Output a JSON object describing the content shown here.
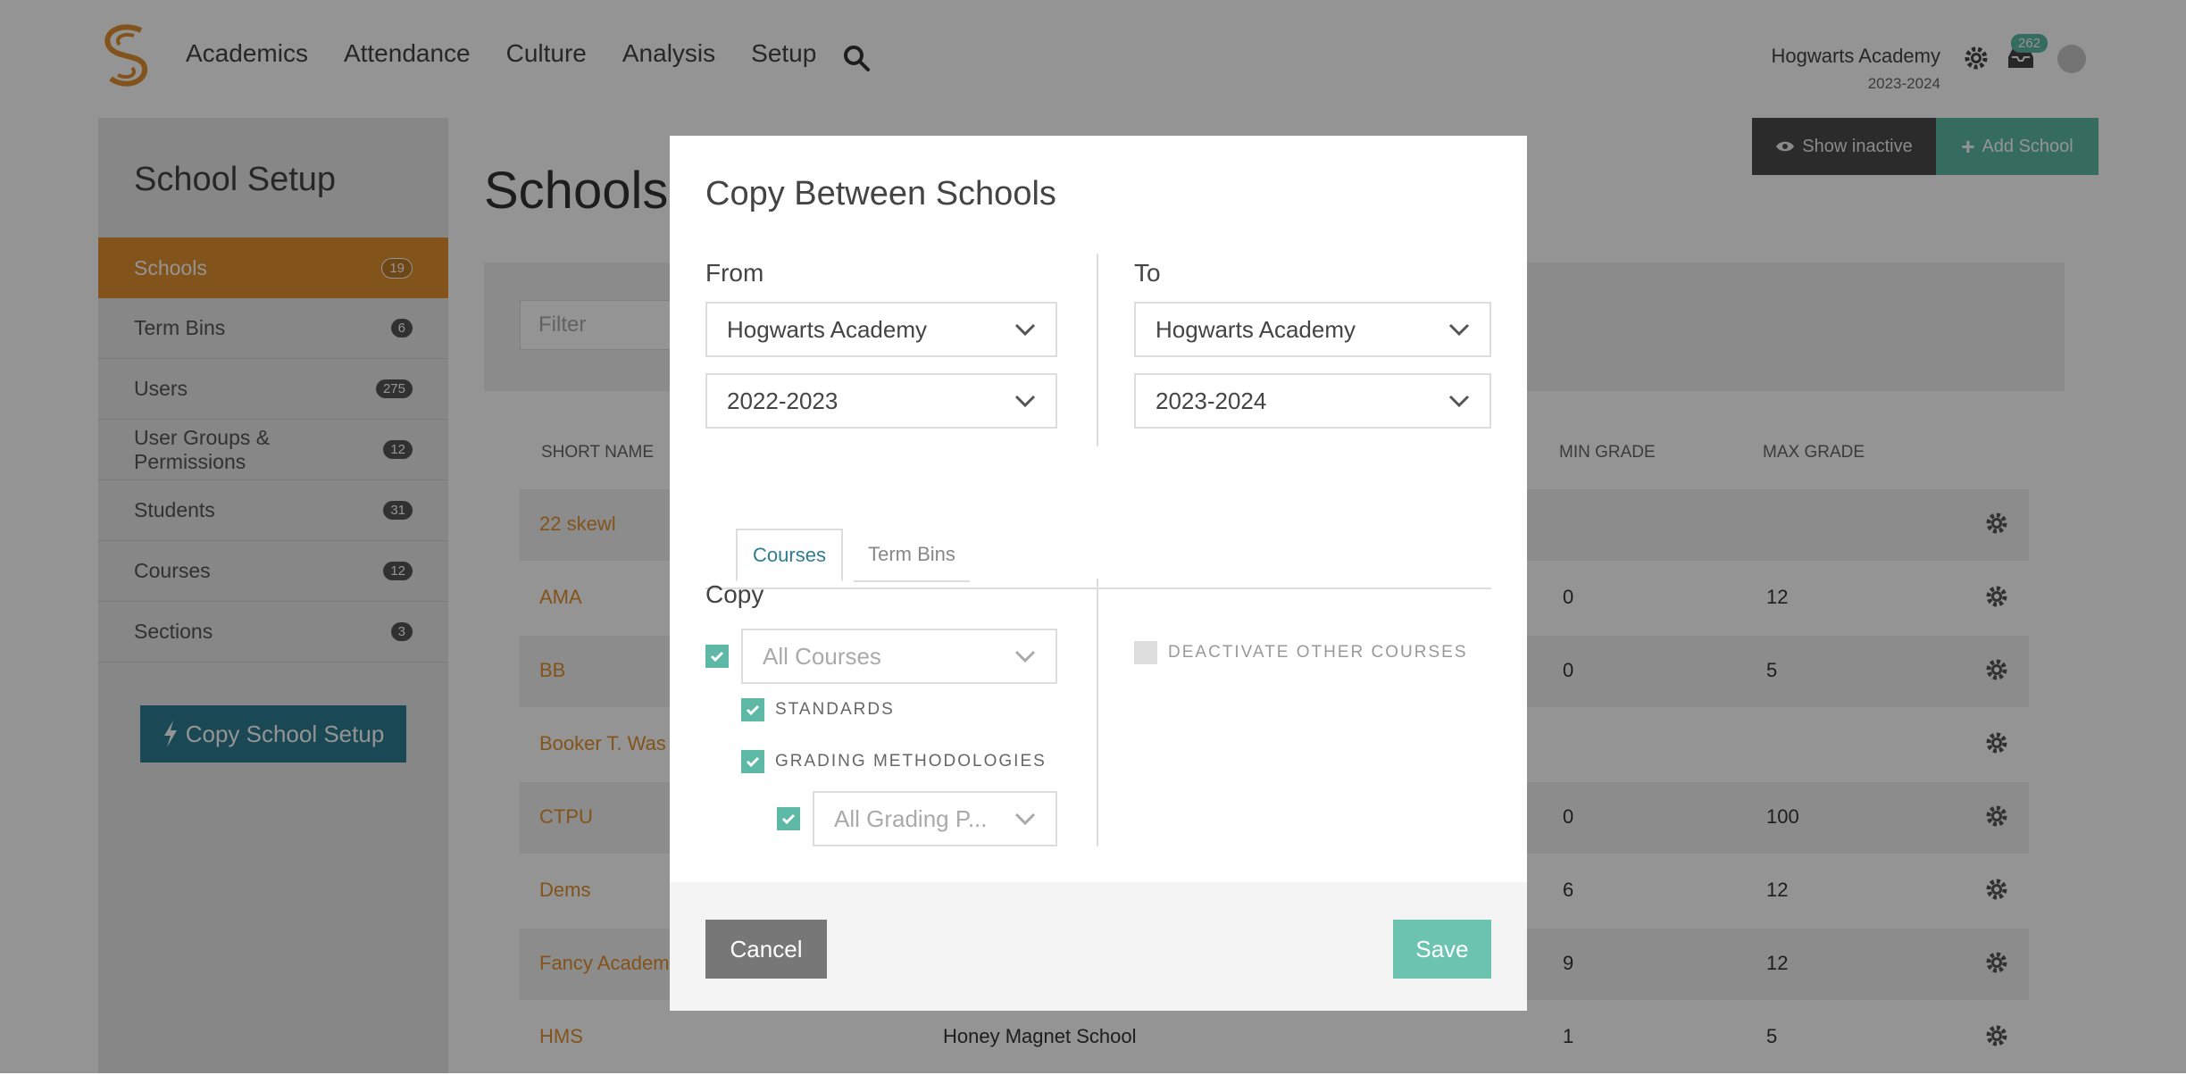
{
  "nav": {
    "links": [
      "Academics",
      "Attendance",
      "Culture",
      "Analysis",
      "Setup"
    ],
    "school_name": "Hogwarts Academy",
    "school_year": "2023-2024",
    "inbox_count": "262",
    "icons": [
      "search-icon",
      "gear-icon",
      "inbox-icon",
      "avatar-icon"
    ]
  },
  "sidebar": {
    "title": "School Setup",
    "items": [
      {
        "label": "Schools",
        "count": "19"
      },
      {
        "label": "Term Bins",
        "count": "6"
      },
      {
        "label": "Users",
        "count": "275"
      },
      {
        "label": "User Groups & Permissions",
        "count": "12"
      },
      {
        "label": "Students",
        "count": "31"
      },
      {
        "label": "Courses",
        "count": "12"
      },
      {
        "label": "Sections",
        "count": "3"
      }
    ],
    "copy_button": "Copy School Setup"
  },
  "main": {
    "title": "Schools",
    "show_inactive": "Show inactive",
    "add_school": "Add School",
    "filter_placeholder": "Filter",
    "columns": {
      "short_name": "SHORT NAME",
      "min_grade": "MIN GRADE",
      "max_grade": "MAX GRADE"
    },
    "rows": [
      {
        "short": "22 skewl",
        "long": "",
        "min": "",
        "max": ""
      },
      {
        "short": "AMA",
        "long": "",
        "min": "0",
        "max": "12"
      },
      {
        "short": "BB",
        "long": "",
        "min": "0",
        "max": "5"
      },
      {
        "short": "Booker T. Was",
        "long": "",
        "min": "",
        "max": ""
      },
      {
        "short": "CTPU",
        "long": "",
        "min": "0",
        "max": "100"
      },
      {
        "short": "Dems",
        "long": "",
        "min": "6",
        "max": "12"
      },
      {
        "short": "Fancy Academ",
        "long": "",
        "min": "9",
        "max": "12"
      },
      {
        "short": "HMS",
        "long": "Honey Magnet School",
        "min": "1",
        "max": "5"
      }
    ]
  },
  "modal": {
    "title": "Copy Between Schools",
    "from_label": "From",
    "to_label": "To",
    "from_school": "Hogwarts Academy",
    "from_year": "2022-2023",
    "to_school": "Hogwarts Academy",
    "to_year": "2023-2024",
    "tabs": [
      "Courses",
      "Term Bins"
    ],
    "copy_label": "Copy",
    "courses_select": "All Courses",
    "standards": "STANDARDS",
    "grading_methodologies": "GRADING METHODOLOGIES",
    "grading_select": "All Grading P...",
    "deactivate": "DEACTIVATE OTHER COURSES",
    "cancel": "Cancel",
    "save": "Save"
  },
  "colors": {
    "accent_orange": "#e0902e",
    "accent_teal": "#5db8a5",
    "primary_blue": "#2d7d92"
  }
}
